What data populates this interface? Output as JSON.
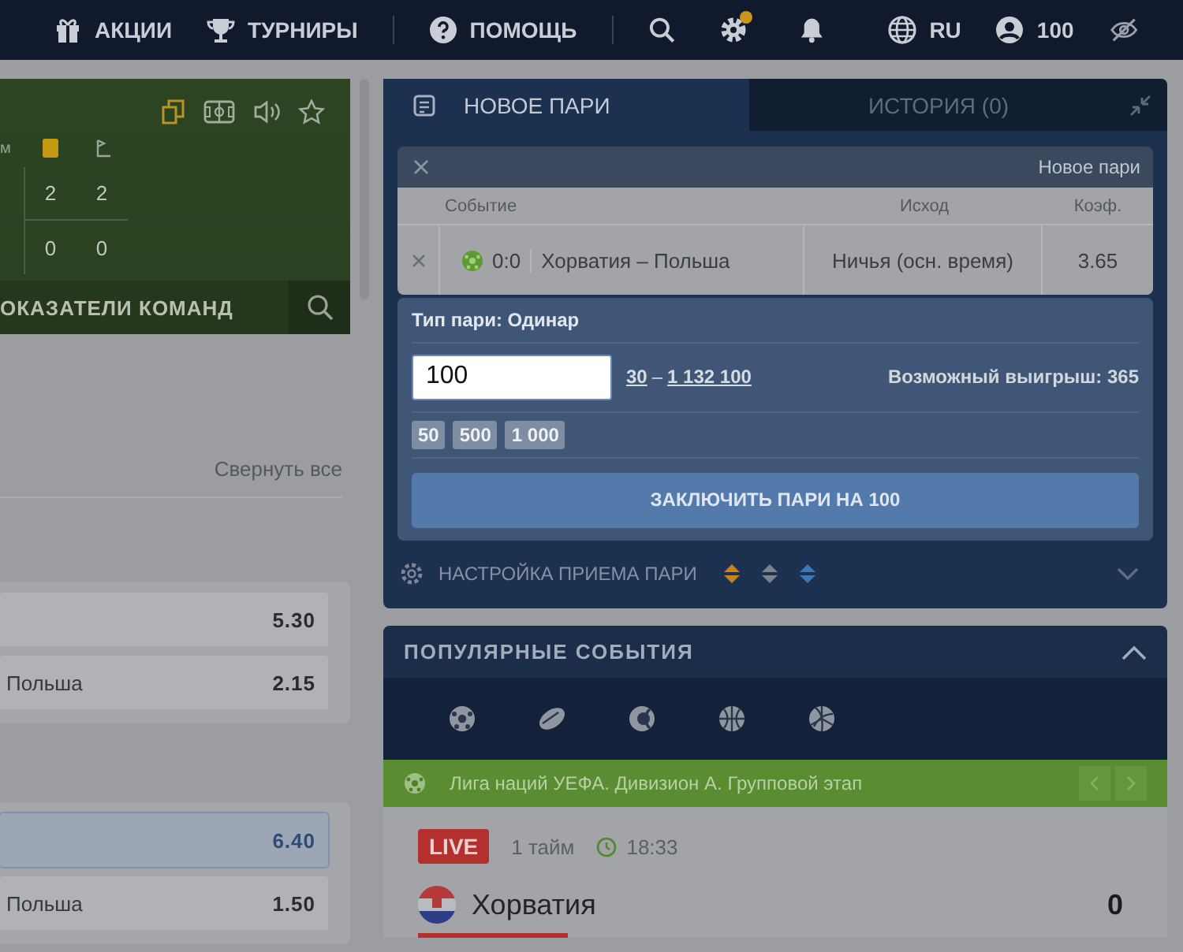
{
  "top_nav": {
    "links": [
      {
        "kind": "gift",
        "label": "АКЦИИ"
      },
      {
        "kind": "trophy",
        "label": "ТУРНИРЫ"
      },
      {
        "kind": "help",
        "label": "ПОМОЩЬ"
      }
    ],
    "language": "RU",
    "balance": "100",
    "settings_alert": true
  },
  "match_panel": {
    "stat_header": "м",
    "scores": [
      [
        "2",
        "2"
      ],
      [
        "0",
        "0"
      ]
    ],
    "stats_tab": "ОКАЗАТЕЛИ КОМАНД"
  },
  "markets": {
    "collapse_all": "Свернуть все",
    "groups": [
      [
        {
          "odds": "5.30",
          "selected": false
        },
        {
          "label": "Польша",
          "odds": "2.15",
          "selected": false
        }
      ],
      [
        {
          "odds": "6.40",
          "selected": true
        },
        {
          "label": "Польша",
          "odds": "1.50",
          "selected": false
        }
      ]
    ]
  },
  "bet_slip": {
    "tabs": [
      {
        "label": "НОВОЕ ПАРИ",
        "selected": true
      },
      {
        "label": "ИСТОРИЯ (0)",
        "selected": false
      }
    ],
    "card_title": "Новое пари",
    "columns": [
      "Событие",
      "Исход",
      "Коэф."
    ],
    "bets": [
      {
        "score": "0:0",
        "event": "Хорватия – Польша",
        "outcome": "Ничья (осн. время)",
        "odds": "3.65"
      }
    ],
    "bet_type": "Тип пари: Одинар",
    "stake": "100",
    "min": "30",
    "range_separator": "–",
    "max": "1 132 100",
    "possible_win": "Возможный выигрыш: 365",
    "quick_stakes": [
      "50",
      "500",
      "1 000"
    ],
    "submit": "ЗАКЛЮЧИТЬ ПАРИ НА 100",
    "settings_label": "НАСТРОЙКА ПРИЕМА ПАРИ",
    "odds_change_options": [
      {
        "color": "#c8841e"
      },
      {
        "color": "#7c838e"
      },
      {
        "color": "#3a78b8"
      }
    ]
  },
  "popular": {
    "title": "ПОПУЛЯРНЫЕ СОБЫТИЯ",
    "sports": [
      {
        "kind": "football"
      },
      {
        "kind": "hockey"
      },
      {
        "kind": "tennis"
      },
      {
        "kind": "basketball"
      },
      {
        "kind": "volleyball"
      }
    ],
    "league": "Лига наций УЕФА. Дивизион А. Групповой этап",
    "event": {
      "live": "LIVE",
      "period": "1 тайм",
      "time": "18:33",
      "team": "Хорватия",
      "score": "0"
    }
  }
}
